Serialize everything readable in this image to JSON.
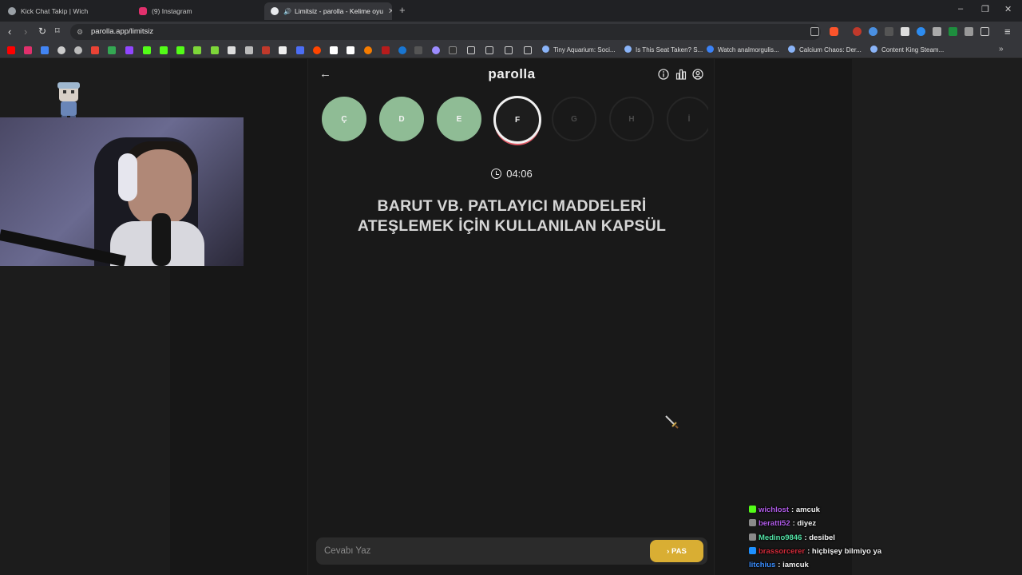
{
  "browser": {
    "tabs": [
      {
        "title": "Kick Chat Takip | Wich",
        "favicon_color": "#9aa0a6",
        "active": false
      },
      {
        "title": "(9) Instagram",
        "favicon_color": "#e1306c",
        "active": false
      },
      {
        "title": "Limitsiz - parolla - Kelime oyu",
        "favicon_color": "#e8eaed",
        "active": true
      }
    ],
    "new_tab": "+",
    "window_controls": [
      "–",
      "❐",
      "✕"
    ],
    "url": "parolla.app/limitsiz",
    "bookmarks": [
      "Tiny Aquarium: Soci...",
      "Is This Seat Taken? S...",
      "Watch analmorgulis...",
      "Calcium Chaos: Der...",
      "Content King Steam..."
    ],
    "bookmarks_more": "»"
  },
  "app": {
    "brand": "parolla",
    "back_icon": "arrow-left-icon",
    "header_icons": [
      "info-icon",
      "stats-icon",
      "account-icon"
    ],
    "letters": [
      {
        "letter": "Ç",
        "state": "done"
      },
      {
        "letter": "D",
        "state": "done"
      },
      {
        "letter": "E",
        "state": "done"
      },
      {
        "letter": "F",
        "state": "current"
      },
      {
        "letter": "G",
        "state": "pending"
      },
      {
        "letter": "H",
        "state": "pending"
      },
      {
        "letter": "İ",
        "state": "pending"
      }
    ],
    "timer": "04:06",
    "question": "BARUT VB. PATLAYICI MADDELERİ ATEŞLEMEK İÇİN KULLANILAN KAPSÜL",
    "answer_placeholder": "Cevabı Yaz",
    "pass_label": "PAS",
    "colors": {
      "done": "#8fbc95",
      "current_ring": "#f1f1f1",
      "current_accent": "#e05a66",
      "pass_button": "#d9ae33"
    }
  },
  "chat": [
    {
      "user": "wichlost",
      "user_color": "#b05ce8",
      "message": "amcuk",
      "badge_color": "#53fc18"
    },
    {
      "user": "beratti52",
      "user_color": "#b05ce8",
      "message": "diyez",
      "badge_color": "#8a8a8a"
    },
    {
      "user": "Medino9846",
      "user_color": "#53e3a6",
      "message": "desibel",
      "badge_color": "#8a8a8a"
    },
    {
      "user": "brassorcerer",
      "user_color": "#d22b3a",
      "message": "hiçbişey bilmiyo ya",
      "badge_color": "#1e90ff"
    },
    {
      "user": "litchius",
      "user_color": "#3a8eff",
      "message": "iamcuk",
      "badge_color": ""
    }
  ]
}
